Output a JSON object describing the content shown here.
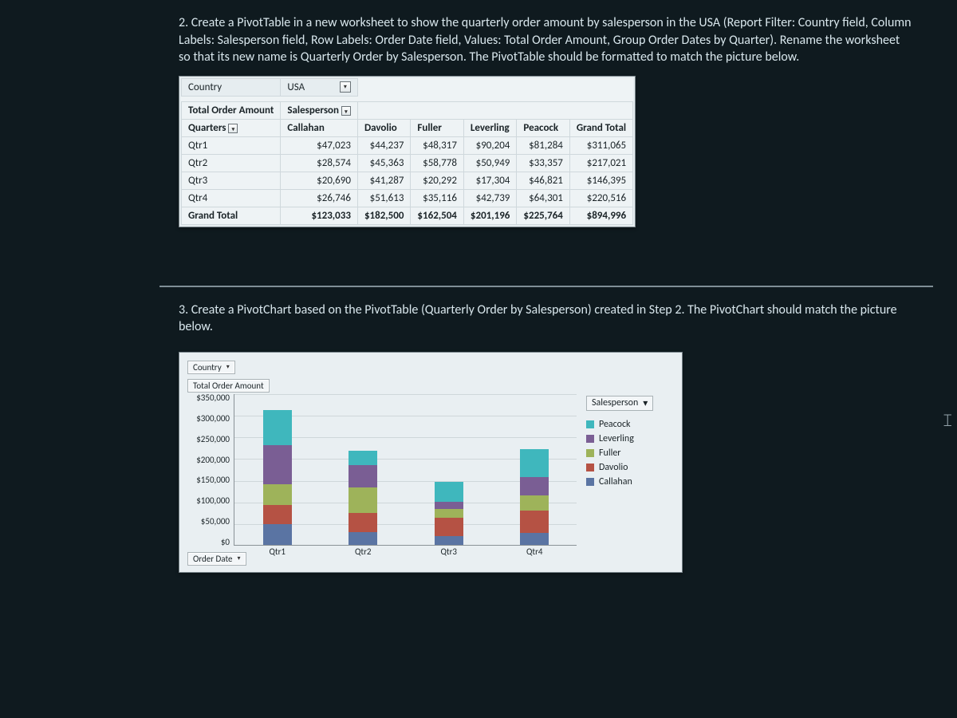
{
  "instr2": "2. Create a PivotTable in a new worksheet to show the quarterly order amount by salesperson in the USA (Report Filter: Country field, Column Labels: Salesperson field, Row Labels: Order Date field, Values: Total Order Amount, Group Order Dates by Quarter). Rename the worksheet so that its new name is Quarterly Order by Salesperson. The PivotTable should be formatted to match the picture below.",
  "instr3": "3. Create a PivotChart based on the PivotTable (Quarterly Order by Salesperson) created in Step 2. The PivotChart should match the picture below.",
  "pivot": {
    "filter_label": "Country",
    "filter_value": "USA",
    "values_label": "Total Order Amount",
    "col_field": "Salesperson",
    "row_field": "Quarters",
    "columns": [
      "Callahan",
      "Davolio",
      "Fuller",
      "Leverling",
      "Peacock"
    ],
    "grand_col": "Grand Total",
    "rows": [
      "Qtr1",
      "Qtr2",
      "Qtr3",
      "Qtr4"
    ],
    "grand_row": "Grand Total",
    "data": [
      [
        "$47,023",
        "$44,237",
        "$48,317",
        "$90,204",
        "$81,284",
        "$311,065"
      ],
      [
        "$28,574",
        "$45,363",
        "$58,778",
        "$50,949",
        "$33,357",
        "$217,021"
      ],
      [
        "$20,690",
        "$41,287",
        "$20,292",
        "$17,304",
        "$46,821",
        "$146,395"
      ],
      [
        "$26,746",
        "$51,613",
        "$35,116",
        "$42,739",
        "$64,301",
        "$220,516"
      ]
    ],
    "grand": [
      "$123,033",
      "$182,500",
      "$162,504",
      "$201,196",
      "$225,764",
      "$894,996"
    ]
  },
  "chart": {
    "filter_btn": "Country",
    "values_btn": "Total Order Amount",
    "col_btn": "Salesperson",
    "row_btn": "Order Date",
    "yticks": [
      "$350,000",
      "$300,000",
      "$250,000",
      "$200,000",
      "$150,000",
      "$100,000",
      "$50,000",
      "$0"
    ]
  },
  "chart_data": {
    "type": "bar",
    "stacked": true,
    "title": "Total Order Amount",
    "xlabel": "Order Date",
    "ylabel": "",
    "ylim": [
      0,
      350000
    ],
    "categories": [
      "Qtr1",
      "Qtr2",
      "Qtr3",
      "Qtr4"
    ],
    "series": [
      {
        "name": "Callahan",
        "color": "#5a74a3",
        "values": [
          47023,
          28574,
          20690,
          26746
        ]
      },
      {
        "name": "Davolio",
        "color": "#b55244",
        "values": [
          44237,
          45363,
          41287,
          51613
        ]
      },
      {
        "name": "Fuller",
        "color": "#9eb35a",
        "values": [
          48317,
          58778,
          20292,
          35116
        ]
      },
      {
        "name": "Leverling",
        "color": "#7a5e94",
        "values": [
          90204,
          50949,
          17304,
          42739
        ]
      },
      {
        "name": "Peacock",
        "color": "#3fb7bd",
        "values": [
          81284,
          33357,
          46821,
          64301
        ]
      }
    ],
    "legend_order": [
      "Peacock",
      "Leverling",
      "Fuller",
      "Davolio",
      "Callahan"
    ]
  }
}
